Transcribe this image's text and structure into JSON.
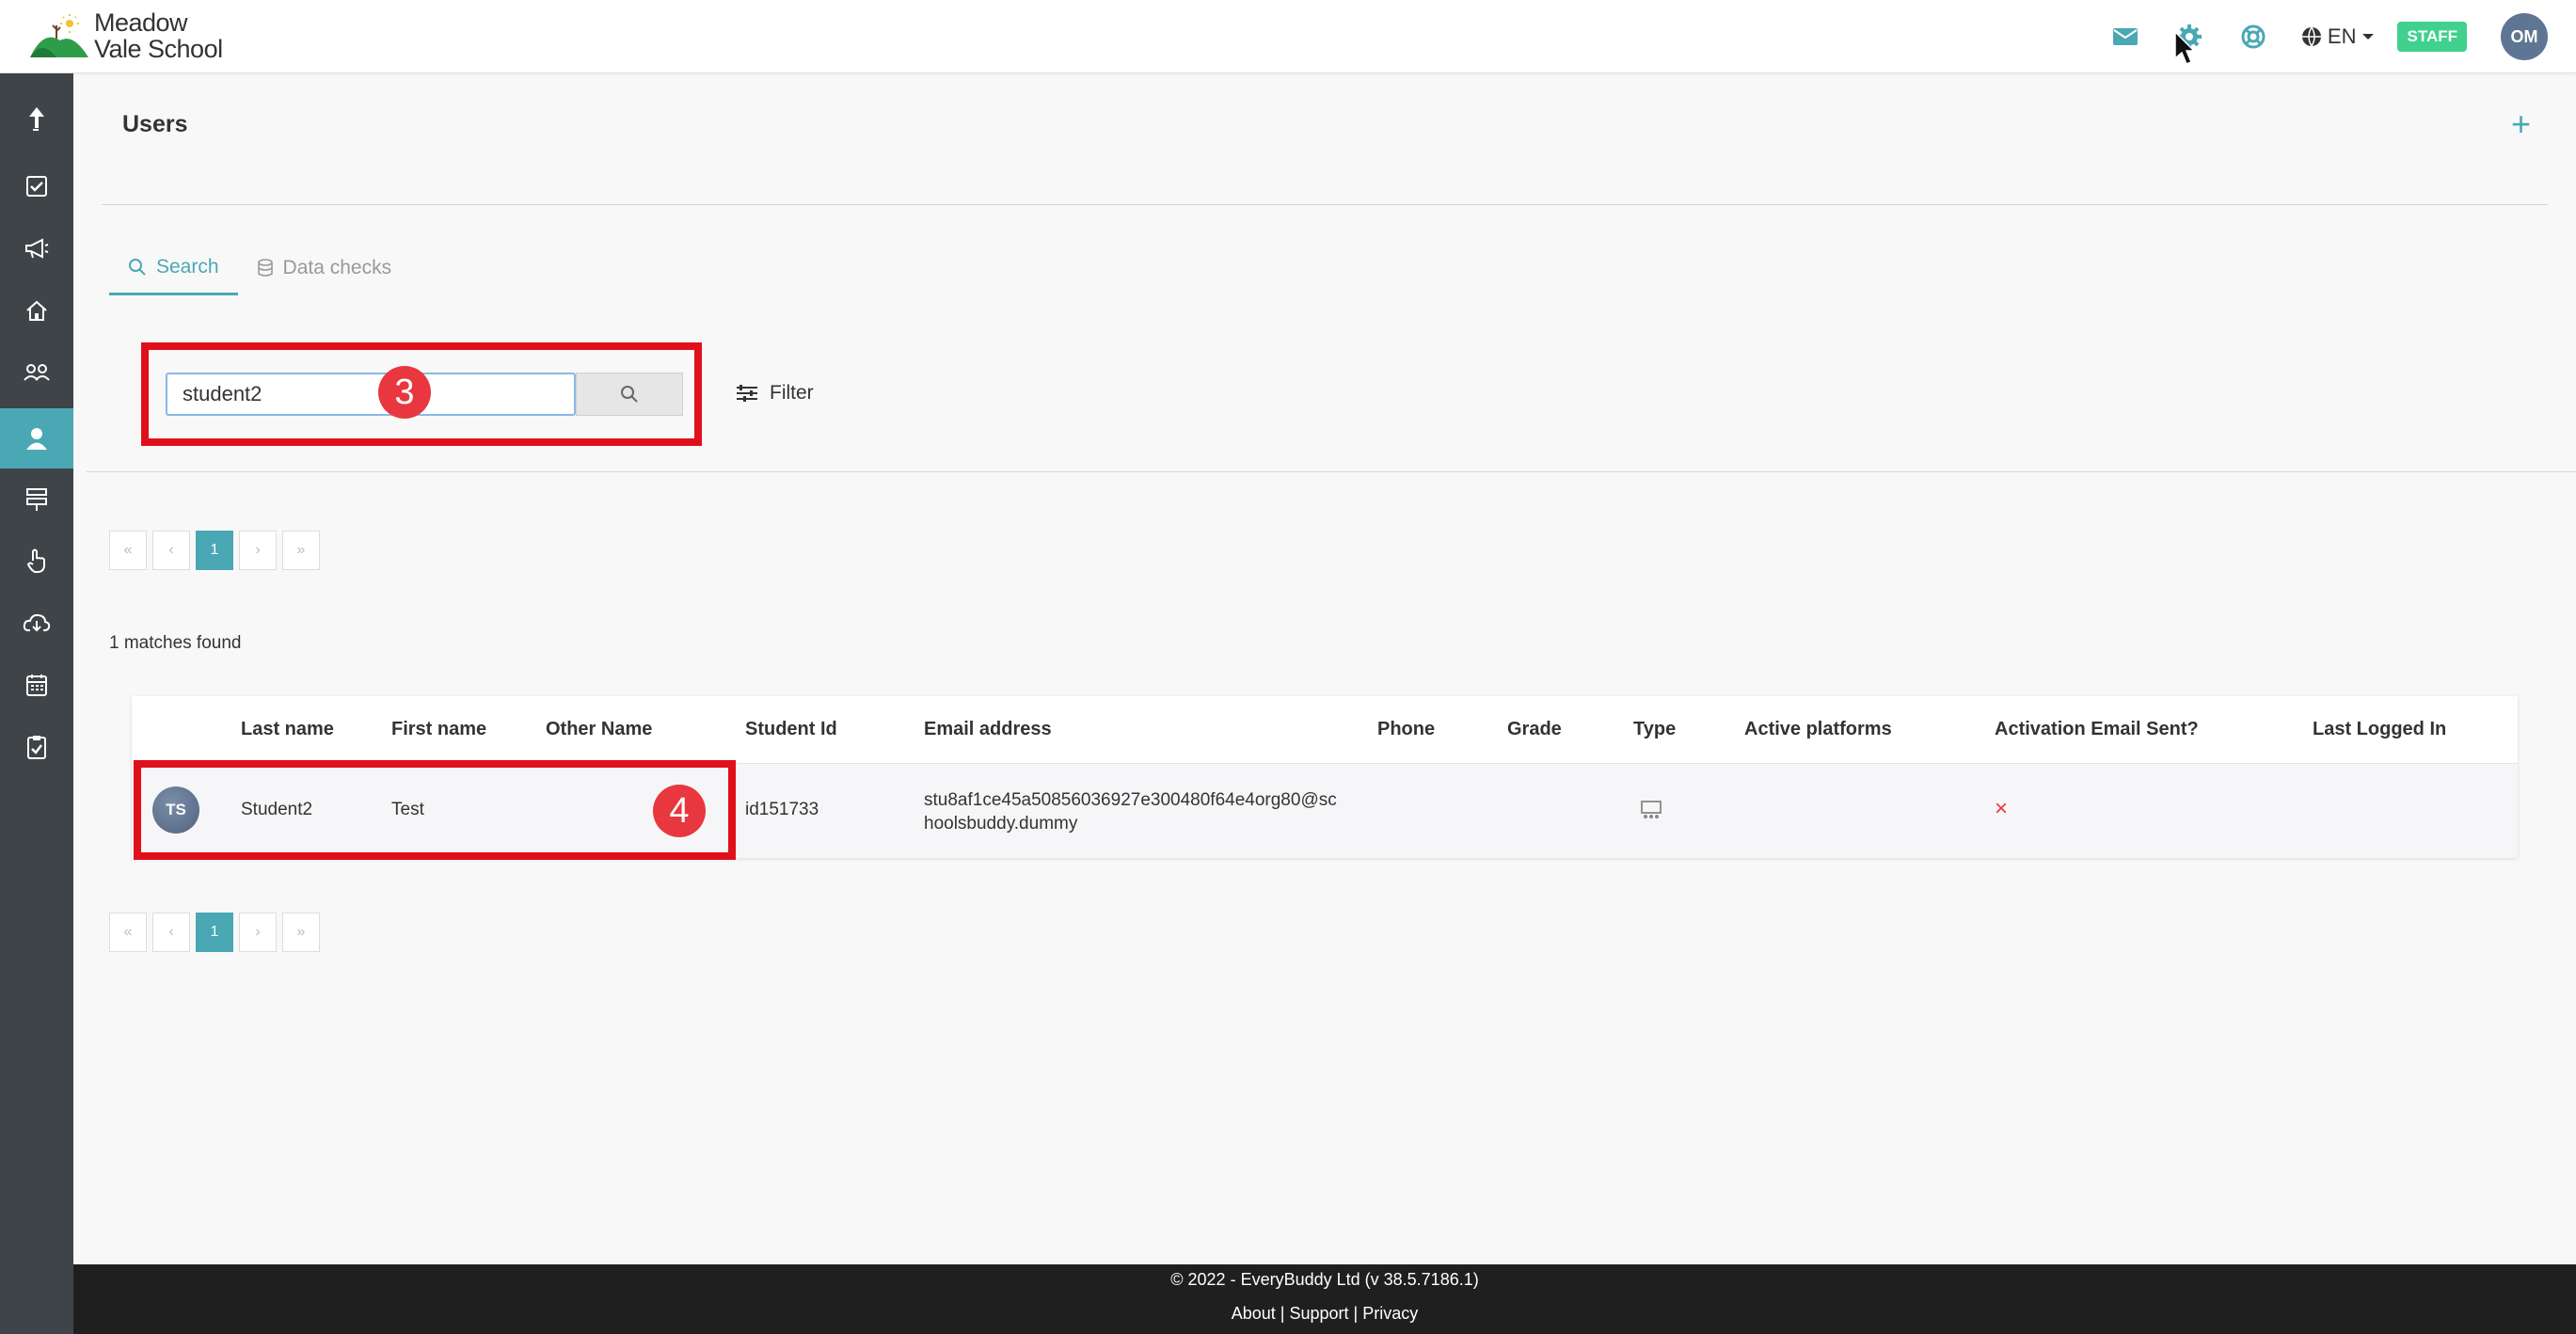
{
  "logo": {
    "line1": "Meadow",
    "line2": "Vale School"
  },
  "topbar": {
    "language": "EN",
    "staff_badge": "STAFF",
    "avatar_initials": "OM"
  },
  "page": {
    "title": "Users",
    "add_label": "+"
  },
  "tabs": [
    {
      "label": "Search",
      "active": true
    },
    {
      "label": "Data checks",
      "active": false
    }
  ],
  "search": {
    "value": "student2",
    "filter_label": "Filter"
  },
  "pagination": {
    "first": "«",
    "prev": "‹",
    "current": "1",
    "next": "›",
    "last": "»"
  },
  "results": {
    "matches_text": "1 matches found"
  },
  "table": {
    "headers": [
      "Last name",
      "First name",
      "Other Name",
      "Student Id",
      "Email address",
      "Phone",
      "Grade",
      "Type",
      "Active platforms",
      "Activation Email Sent?",
      "Last Logged In"
    ],
    "rows": [
      {
        "initials": "TS",
        "last_name": "Student2",
        "first_name": "Test",
        "other_name": "",
        "student_id": "id151733",
        "email_line1": "stu8af1ce45a50856036927e300480f64e4org80@sc",
        "email_line2": "hoolsbuddy.dummy",
        "phone": "",
        "grade": "",
        "type_icon": "classroom-icon",
        "active_platforms": "",
        "activation_email_sent": "×",
        "last_logged_in": ""
      }
    ]
  },
  "annotations": {
    "step3": "3",
    "step4": "4"
  },
  "footer": {
    "copyright": "© 2022 - EveryBuddy Ltd (v 38.5.7186.1)",
    "about": "About",
    "support": "Support",
    "privacy": "Privacy",
    "separator": "|"
  },
  "colors": {
    "accent": "#4aa8b5",
    "sidebar": "#3f4448",
    "staff": "#3fd18d",
    "annotation": "#e0101b",
    "error": "#e8373e"
  }
}
